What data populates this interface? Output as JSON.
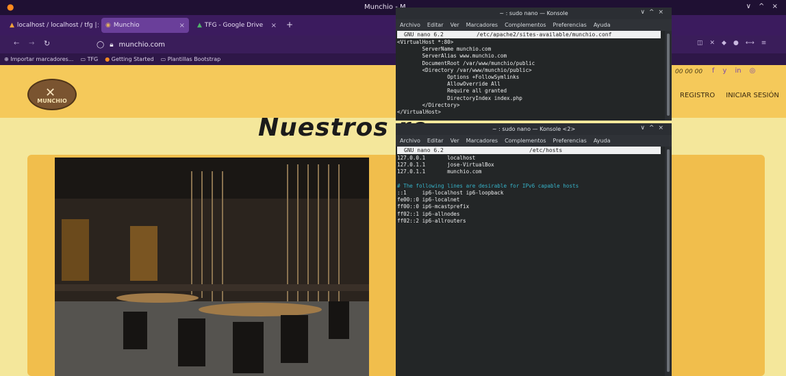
{
  "firefox": {
    "window_title": "Munchio - M",
    "tabs": [
      {
        "label": "localhost / localhost / tfg |",
        "close": "×"
      },
      {
        "label": "Munchio",
        "close": "×"
      },
      {
        "label": "TFG - Google Drive",
        "close": "×"
      }
    ],
    "new_tab": "+",
    "url": "munchio.com",
    "bookmarks": [
      "Importar marcadores...",
      "TFG",
      "Getting Started",
      "Plantillas Bootstrap"
    ],
    "window_controls": "∨ ^ ×"
  },
  "site": {
    "logo_text": "MUNCHIO",
    "phone": "00 00 00",
    "socials": [
      "f",
      "y",
      "in",
      "◎"
    ],
    "nav": [
      "REGISTRO",
      "INICIAR SESIÓN"
    ],
    "heading": "Nuestros re"
  },
  "konsole1": {
    "title": "~ : sudo nano — Konsole",
    "menu": [
      "Archivo",
      "Editar",
      "Ver",
      "Marcadores",
      "Complementos",
      "Preferencias",
      "Ayuda"
    ],
    "nano_header": "GNU nano 6.2          /etc/apache2/sites-available/munchio.conf",
    "lines": [
      "<VirtualHost *:80>",
      "        ServerName munchio.com",
      "        ServerAlias www.munchio.com",
      "        DocumentRoot /var/www/munchio/public",
      "        <Directory /var/www/munchio/public>",
      "                Options +FollowSymlinks",
      "                AllowOverride All",
      "                Require all granted",
      "                DirectoryIndex index.php",
      "        </Directory>",
      "</VirtualHost>"
    ]
  },
  "konsole2": {
    "title": "~ : sudo nano — Konsole <2>",
    "menu": [
      "Archivo",
      "Editar",
      "Ver",
      "Marcadores",
      "Complementos",
      "Preferencias",
      "Ayuda"
    ],
    "nano_header": "GNU nano 6.2                          /etc/hosts",
    "lines": [
      "127.0.0.1       localhost",
      "127.0.1.1       jose-VirtualBox",
      "127.0.1.1       munchio.com",
      "",
      "# The following lines are desirable for IPv6 capable hosts",
      "::1     ip6-localhost ip6-loopback",
      "fe00::0 ip6-localnet",
      "ff00::0 ip6-mcastprefix",
      "ff02::1 ip6-allnodes",
      "ff02::2 ip6-allrouters"
    ]
  }
}
